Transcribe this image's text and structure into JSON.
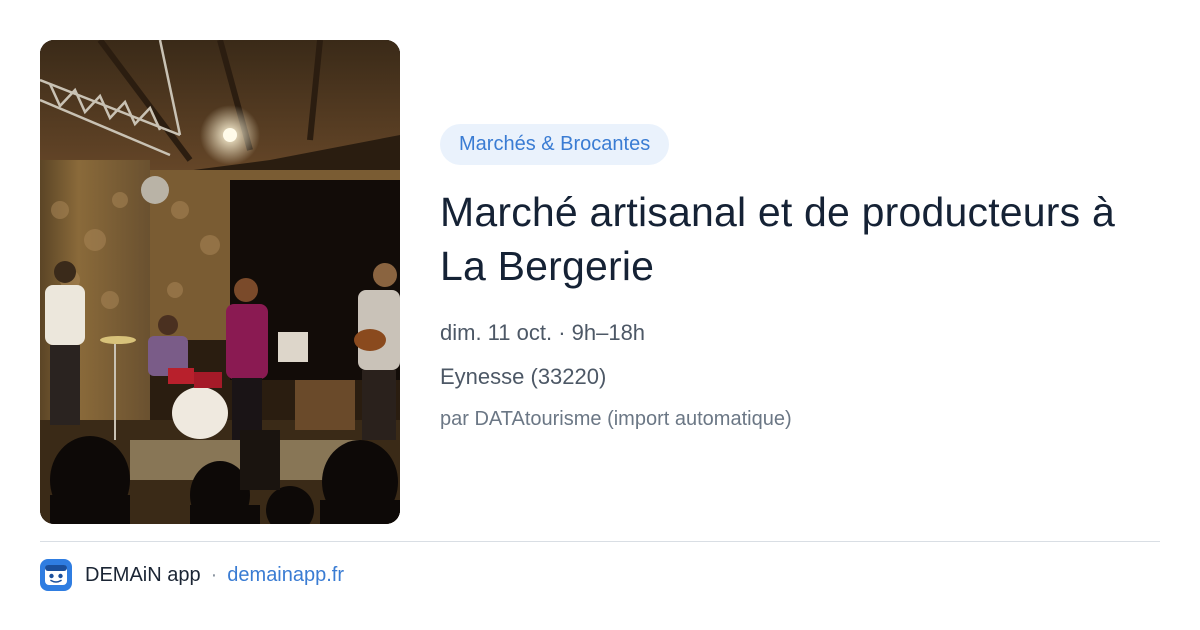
{
  "event": {
    "category": "Marchés & Brocantes",
    "title": "Marché artisanal et de producteurs à La Bergerie",
    "date": "dim. 11 oct. · 9h–18h",
    "location": "Eynesse (33220)",
    "source": "par DATAtourisme (import automatique)"
  },
  "footer": {
    "app_name": "DEMAiN app",
    "separator": "·",
    "url": "demainapp.fr",
    "icon": "demain-app-icon"
  },
  "colors": {
    "accent": "#3a7cd3",
    "badge_bg": "#eaf2fc",
    "title": "#152235",
    "meta": "#4d5866",
    "app_icon": "#2f7de1"
  }
}
